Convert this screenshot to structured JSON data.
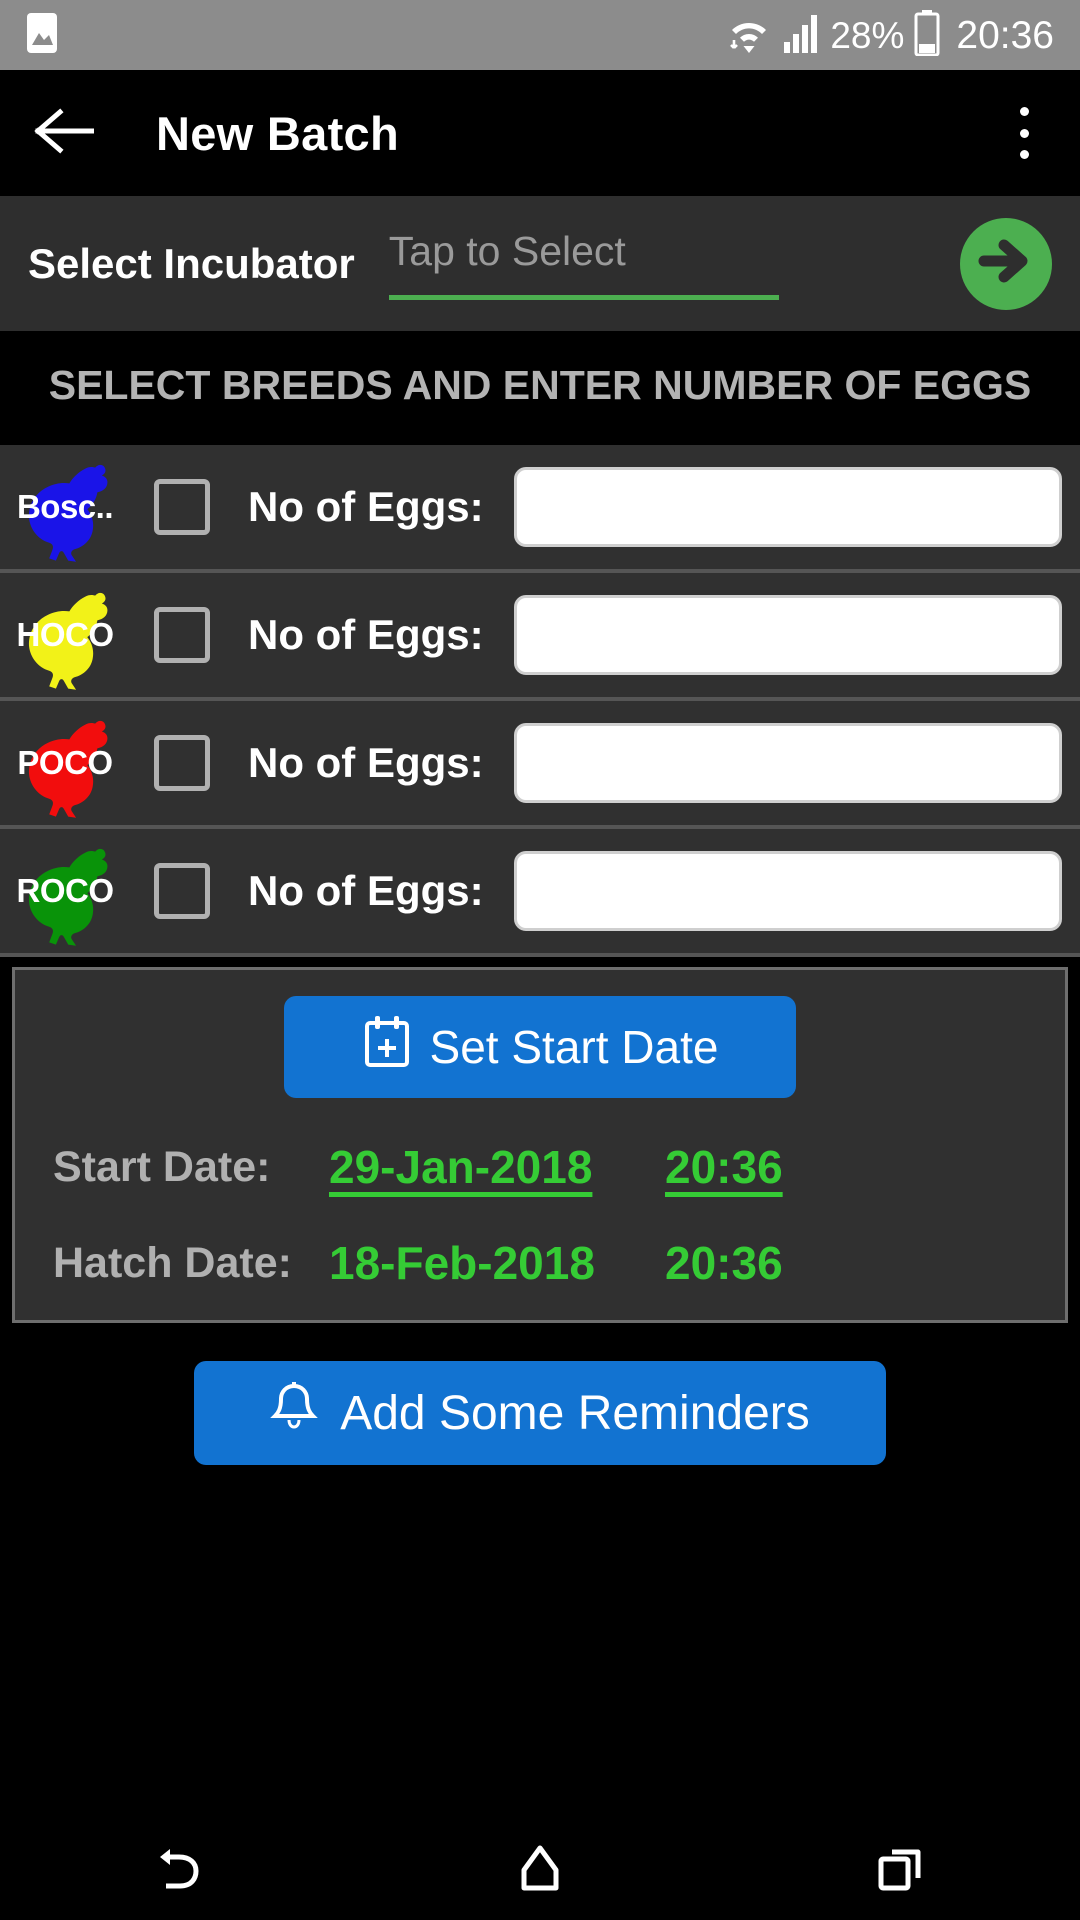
{
  "status_bar": {
    "gallery_icon": "image-icon",
    "wifi_icon": "wifi-icon",
    "signal_icon": "cellular-signal-icon",
    "battery_percent": "28%",
    "battery_icon": "battery-icon",
    "clock": "20:36"
  },
  "app_bar": {
    "back_icon": "back-arrow-icon",
    "title": "New Batch",
    "overflow_icon": "more-vertical-icon"
  },
  "incubator": {
    "label": "Select Incubator",
    "placeholder": "Tap to Select",
    "value": "",
    "next_icon": "arrow-right-icon",
    "accent_color": "#4caf50"
  },
  "section": {
    "heading": "SELECT BREEDS AND ENTER NUMBER OF EGGS"
  },
  "breeds": [
    {
      "name": "Bosc..",
      "color": "#1a14e8",
      "icon": "chicken-icon",
      "eggs_label": "No of Eggs:",
      "eggs_value": "",
      "checked": false
    },
    {
      "name": "HOCO",
      "color": "#f2f218",
      "icon": "chicken-icon",
      "eggs_label": "No of Eggs:",
      "eggs_value": "",
      "checked": false
    },
    {
      "name": "POCO",
      "color": "#f20d0d",
      "icon": "chicken-icon",
      "eggs_label": "No of Eggs:",
      "eggs_value": "",
      "checked": false
    },
    {
      "name": "ROCO",
      "color": "#099309",
      "icon": "chicken-icon",
      "eggs_label": "No of Eggs:",
      "eggs_value": "",
      "checked": false
    }
  ],
  "dates": {
    "set_start_date_label": "Set Start Date",
    "set_start_date_icon": "calendar-plus-icon",
    "start_label": "Start Date:",
    "start_date": "29-Jan-2018",
    "start_time": "20:36",
    "hatch_label": "Hatch Date:",
    "hatch_date": "18-Feb-2018",
    "hatch_time": "20:36",
    "date_color": "#35cc35"
  },
  "reminders": {
    "label": "Add Some Reminders",
    "icon": "bell-icon",
    "color": "#1273d1"
  },
  "nav_bar": {
    "back": "nav-back-icon",
    "home": "nav-home-icon",
    "recents": "nav-recents-icon"
  }
}
